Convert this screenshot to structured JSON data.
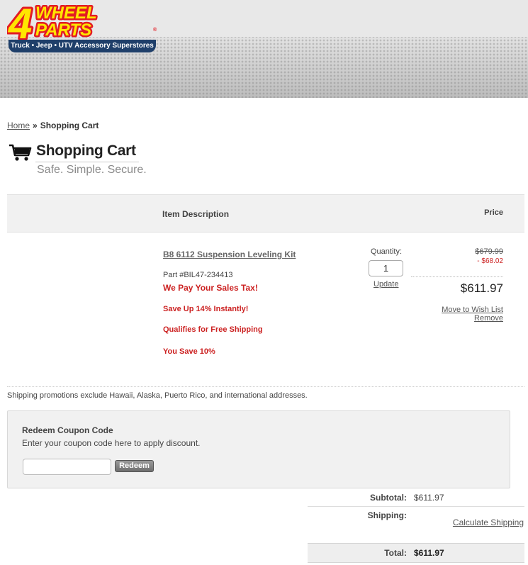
{
  "header": {
    "logo_text": "4WHEEL PARTS",
    "logo_tagline": "Truck • Jeep • UTV  Accessory Superstores"
  },
  "breadcrumb": {
    "home": "Home",
    "separator": "»",
    "current": "Shopping Cart"
  },
  "page": {
    "title": "Shopping Cart",
    "subtitle": "Safe. Simple. Secure."
  },
  "table": {
    "col_description": "Item Description",
    "col_price": "Price"
  },
  "item": {
    "name": "B8 6112 Suspension Leveling Kit",
    "part": "Part #BIL47-234413",
    "promos": [
      "We Pay Your Sales Tax!",
      "Save Up 14% Instantly!",
      "Qualifies for Free Shipping",
      "You Save 10%"
    ],
    "quantity_label": "Quantity:",
    "quantity": "1",
    "update_label": "Update",
    "price_original": "$679.99",
    "price_discount": "- $68.02",
    "price_now": "$611.97",
    "wishlist_label": "Move to Wish List",
    "remove_label": "Remove"
  },
  "shipping_note": "Shipping promotions exclude Hawaii, Alaska, Puerto Rico, and international addresses.",
  "coupon": {
    "title": "Redeem Coupon Code",
    "description": "Enter your coupon code here to apply discount.",
    "input_value": "",
    "button_label": "Redeem"
  },
  "totals": {
    "subtotal_label": "Subtotal:",
    "subtotal_value": "$611.97",
    "shipping_label": "Shipping:",
    "calculate_shipping": "Calculate Shipping",
    "total_label": "Total:",
    "total_value": "$611.97"
  },
  "colors": {
    "logo_yellow": "#ffe600",
    "logo_red": "#e31b23",
    "logo_navy": "#1f3f6a",
    "promo_red": "#cc2222"
  }
}
